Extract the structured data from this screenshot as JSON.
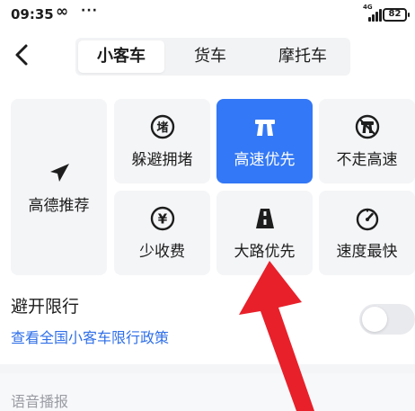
{
  "status_bar": {
    "time": "09:35",
    "infinity": "∞",
    "dots": "···",
    "network": "4G",
    "battery": "82"
  },
  "header": {
    "back_icon": "chevron-left-icon",
    "tabs": [
      {
        "label": "小客车",
        "active": true
      },
      {
        "label": "货车",
        "active": false
      },
      {
        "label": "摩托车",
        "active": false
      }
    ]
  },
  "route_options": {
    "recommend": {
      "label": "高德推荐",
      "icon": "paper-plane-icon",
      "selected": false
    },
    "avoid_congestion": {
      "label": "躲避拥堵",
      "icon": "congestion-icon",
      "icon_text": "堵",
      "selected": false
    },
    "highway_first": {
      "label": "高速优先",
      "icon": "highway-icon",
      "selected": true
    },
    "no_highway": {
      "label": "不走高速",
      "icon": "no-highway-icon",
      "selected": false
    },
    "less_toll": {
      "label": "少收费",
      "icon": "yen-icon",
      "icon_text": "¥",
      "selected": false
    },
    "main_road": {
      "label": "大路优先",
      "icon": "main-road-icon",
      "selected": false
    },
    "fastest": {
      "label": "速度最快",
      "icon": "speedometer-icon",
      "selected": false
    }
  },
  "restriction": {
    "title": "避开限行",
    "link": "查看全国小客车限行政策",
    "toggle_on": false
  },
  "voice": {
    "title": "语音播报"
  },
  "colors": {
    "accent": "#3378f6",
    "link": "#2f6fe8",
    "card_bg": "#f4f5f7",
    "annotation": "#e8202a"
  }
}
